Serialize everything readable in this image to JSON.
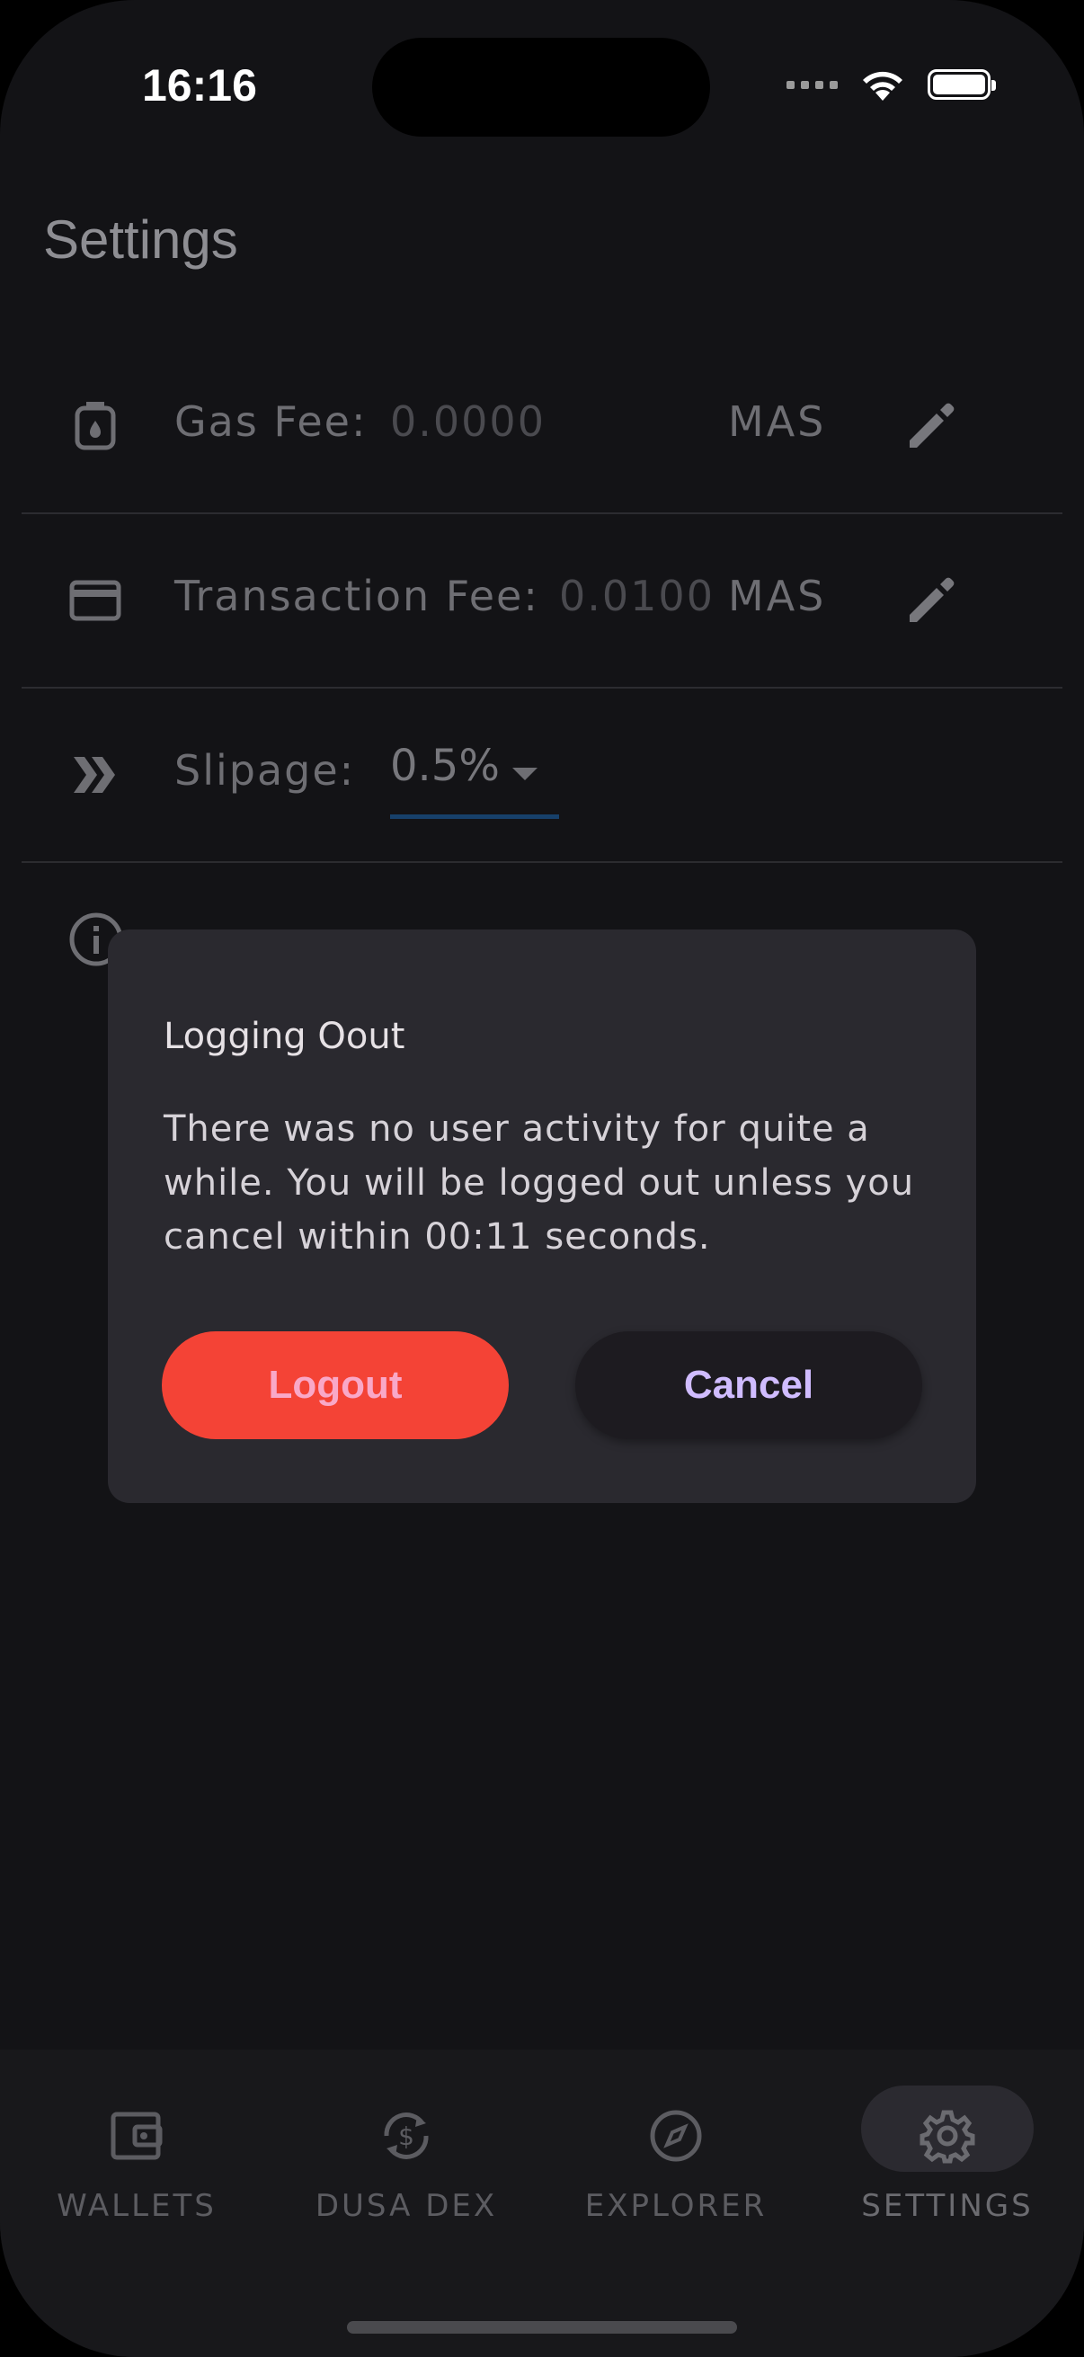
{
  "status_bar": {
    "time": "16:16"
  },
  "page": {
    "title": "Settings"
  },
  "settings": {
    "gas_fee": {
      "label": "Gas Fee:",
      "value": "0.0000",
      "unit": "MAS"
    },
    "transaction_fee": {
      "label": "Transaction Fee:",
      "value": "0.0100",
      "unit": "MAS"
    },
    "slippage": {
      "label": "Slipage:",
      "value": "0.5%"
    }
  },
  "dialog": {
    "title": "Logging Oout",
    "message": "There was no user activity for quite a while. You will be logged out unless you cancel within 00:11 seconds.",
    "logout_label": "Logout",
    "cancel_label": "Cancel"
  },
  "bottom_nav": {
    "items": [
      {
        "label": "WALLETS",
        "icon": "wallet-icon"
      },
      {
        "label": "DUSA DEX",
        "icon": "exchange-dollar-icon"
      },
      {
        "label": "EXPLORER",
        "icon": "compass-icon"
      },
      {
        "label": "SETTINGS",
        "icon": "gear-icon",
        "active": true
      }
    ]
  },
  "colors": {
    "background": "#131316",
    "dialog": "#2a292f",
    "logout_button": "#f44336",
    "cancel_text": "#d0bcff"
  }
}
